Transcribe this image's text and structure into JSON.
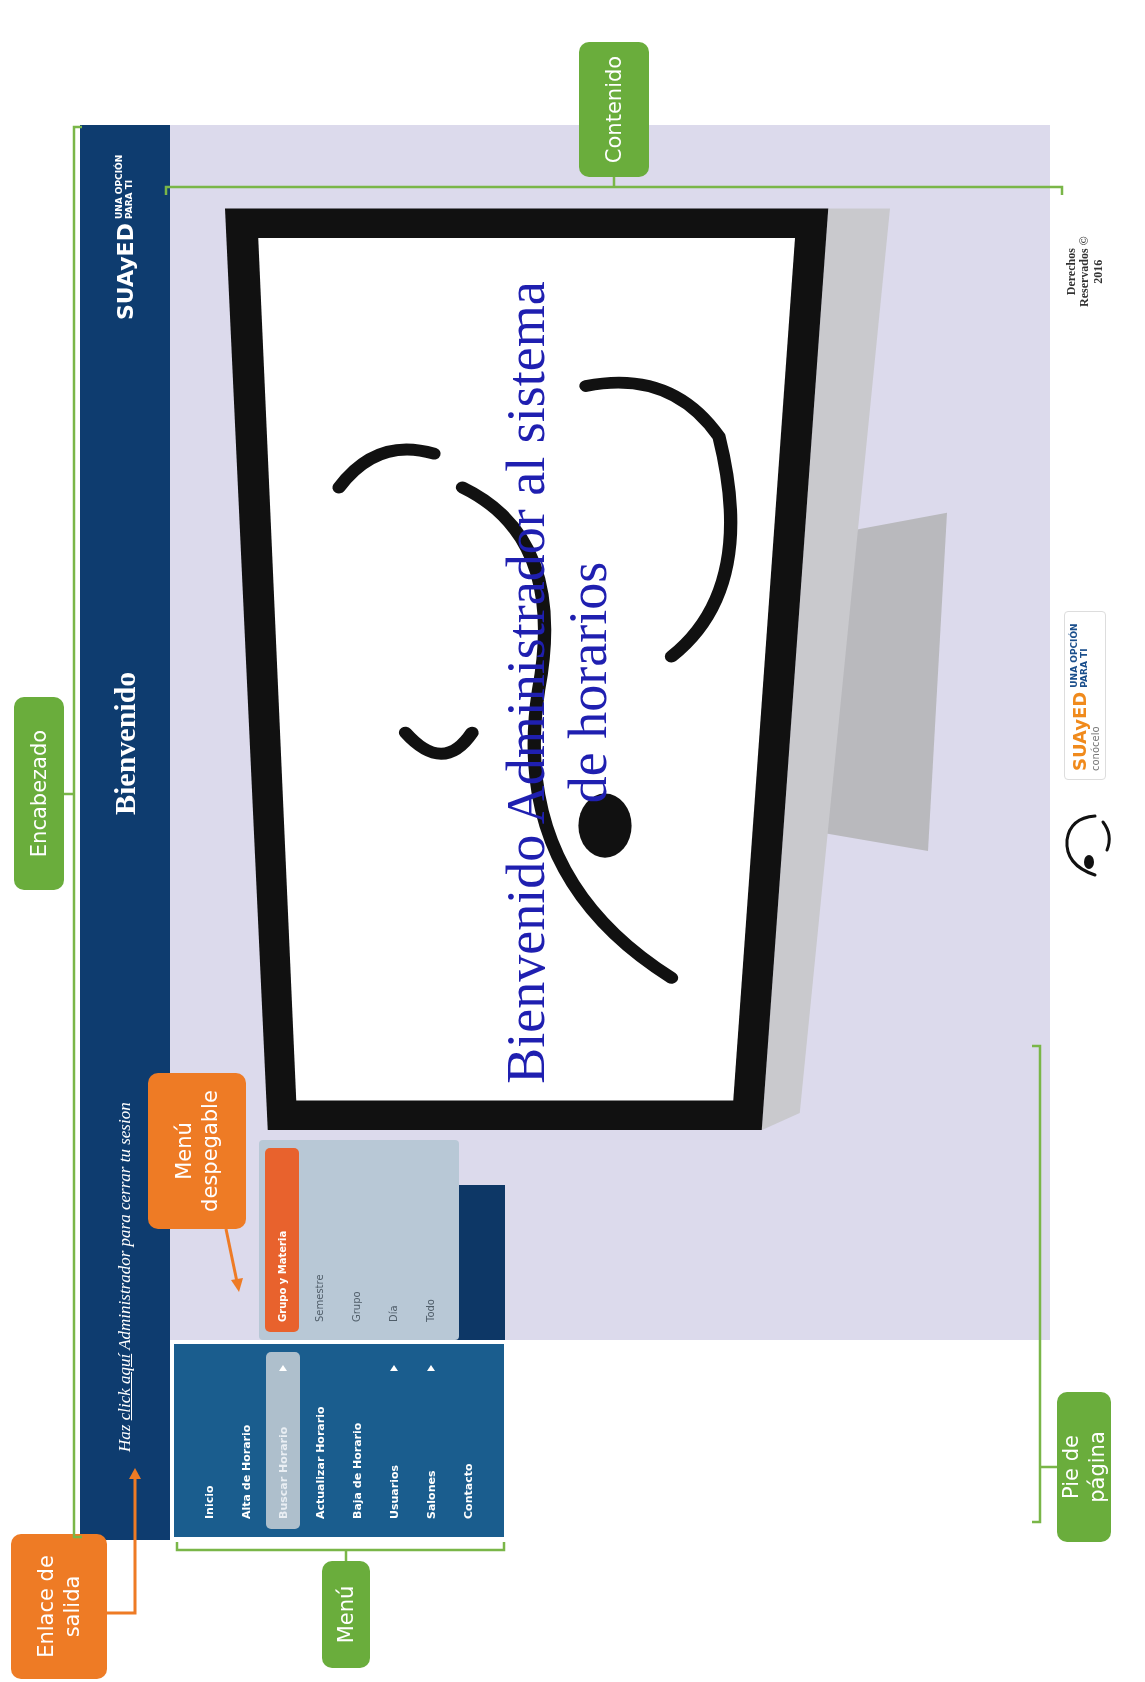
{
  "annotations": [
    {
      "text": "Encabezado",
      "color": "#6aad3c"
    },
    {
      "text": "Contenido",
      "color": "#6aad3c"
    },
    {
      "text": "Menú",
      "color": "#6aad3c"
    },
    {
      "text": "Enlace de salida",
      "color": "#ee7b25"
    },
    {
      "text": "Menú despegable",
      "color": "#ee7b25"
    },
    {
      "text": "Pie de página",
      "color": "#6aad3c"
    }
  ],
  "header": {
    "logout": {
      "prefix": "Haz",
      "link": "click aquí",
      "suffix": "Administrador para cerrar tu sesion"
    },
    "title": "Bienvenido",
    "logo": {
      "name": "SUAyED",
      "tagline": "UNA OPCIÓN PARA TI"
    }
  },
  "menu": {
    "items": [
      {
        "label": "Inicio",
        "selected": false,
        "has_submenu": false
      },
      {
        "label": "Alta de Horario",
        "selected": false,
        "has_submenu": false
      },
      {
        "label": "Buscar Horario",
        "selected": true,
        "has_submenu": true
      },
      {
        "label": "Actualizar Horario",
        "selected": false,
        "has_submenu": false
      },
      {
        "label": "Baja de Horario",
        "selected": false,
        "has_submenu": false
      },
      {
        "label": "Usuarios",
        "selected": false,
        "has_submenu": true
      },
      {
        "label": "Salones",
        "selected": false,
        "has_submenu": true
      },
      {
        "label": "Contacto",
        "selected": false,
        "has_submenu": false
      }
    ]
  },
  "submenu": {
    "items": [
      {
        "label": "Grupo y Materia",
        "selected": true
      },
      {
        "label": "Semestre",
        "selected": false
      },
      {
        "label": "Grupo",
        "selected": false
      },
      {
        "label": "Día",
        "selected": false
      },
      {
        "label": "Todo",
        "selected": false
      }
    ]
  },
  "welcome": "Bienvenido Administrador al sistema de horarios",
  "footer": {
    "badge": {
      "name": "SUAyED",
      "tagline": "UNA OPCIÓN PARA TI",
      "cta": "conócelo"
    },
    "copyright": "Derechos Reservados © 2016"
  }
}
